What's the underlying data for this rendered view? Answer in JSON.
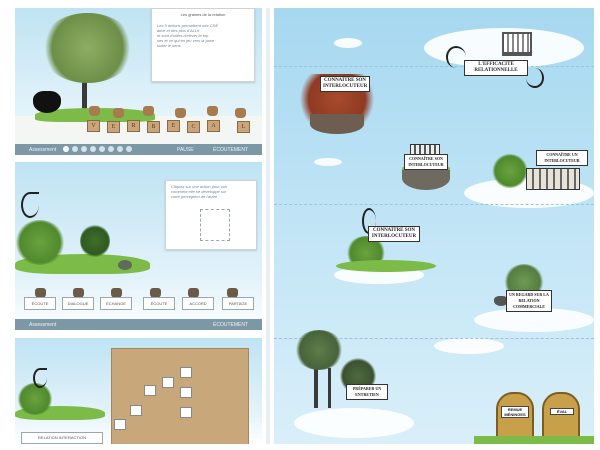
{
  "panel1": {
    "card_lines": [
      "Les graines de la relation",
      "Les 5 actions permettent une CRÉ",
      "ative et des plus d'ALLé",
      "et sont d'utiles d'élever le top",
      "ses et ce qui en jeu vers la pose",
      "suiter le sens"
    ],
    "letters": [
      "V",
      "E",
      "R",
      "B",
      "E",
      "C",
      "A",
      "L"
    ],
    "nav_label": "Assessment",
    "nav_pause": "PAUSE",
    "nav_next": "ÉCOUTEMENT"
  },
  "panel2": {
    "card_lines": [
      "Cliquez sur une action pour voir",
      "comment elle se développe sur",
      "votre perception de l'autre"
    ],
    "choices": [
      "ÉCOUTE",
      "DIALOGUE",
      "ÉCHANGE",
      "ÉCOUTE",
      "ACCORD",
      "PARTAGE"
    ],
    "nav_label": "Assessment",
    "nav_next": "ÉCOUTEMENT"
  },
  "panel3": {
    "bottom_label": "RELATION INTERACTION"
  },
  "map": {
    "signs": {
      "island1": "CONNAÎTRE SON INTERLOCUTEUR",
      "efficacite": "L'EFFICACITÉ RELATIONNELLE",
      "island_mid": "CONNAÎTRE SON INTERLOCUTEUR",
      "island_right": "CONNAÎTRE UN INTERLOCUTEUR",
      "island_center": "CONNAÎTRE SON INTERLOCUTEUR",
      "island_low": "UN REGARD SUR LA RELATION COMMERCIALE",
      "tree_sign": "PRÉPARER UN ENTRETIEN"
    },
    "doors": {
      "left": "REMUE MÉNINGES",
      "right": "ÉVAL"
    }
  },
  "colors": {
    "sky": "#a6d8f0",
    "nav": "#7c97a6",
    "grass": "#6fb33f",
    "door": "#c9a04a"
  }
}
